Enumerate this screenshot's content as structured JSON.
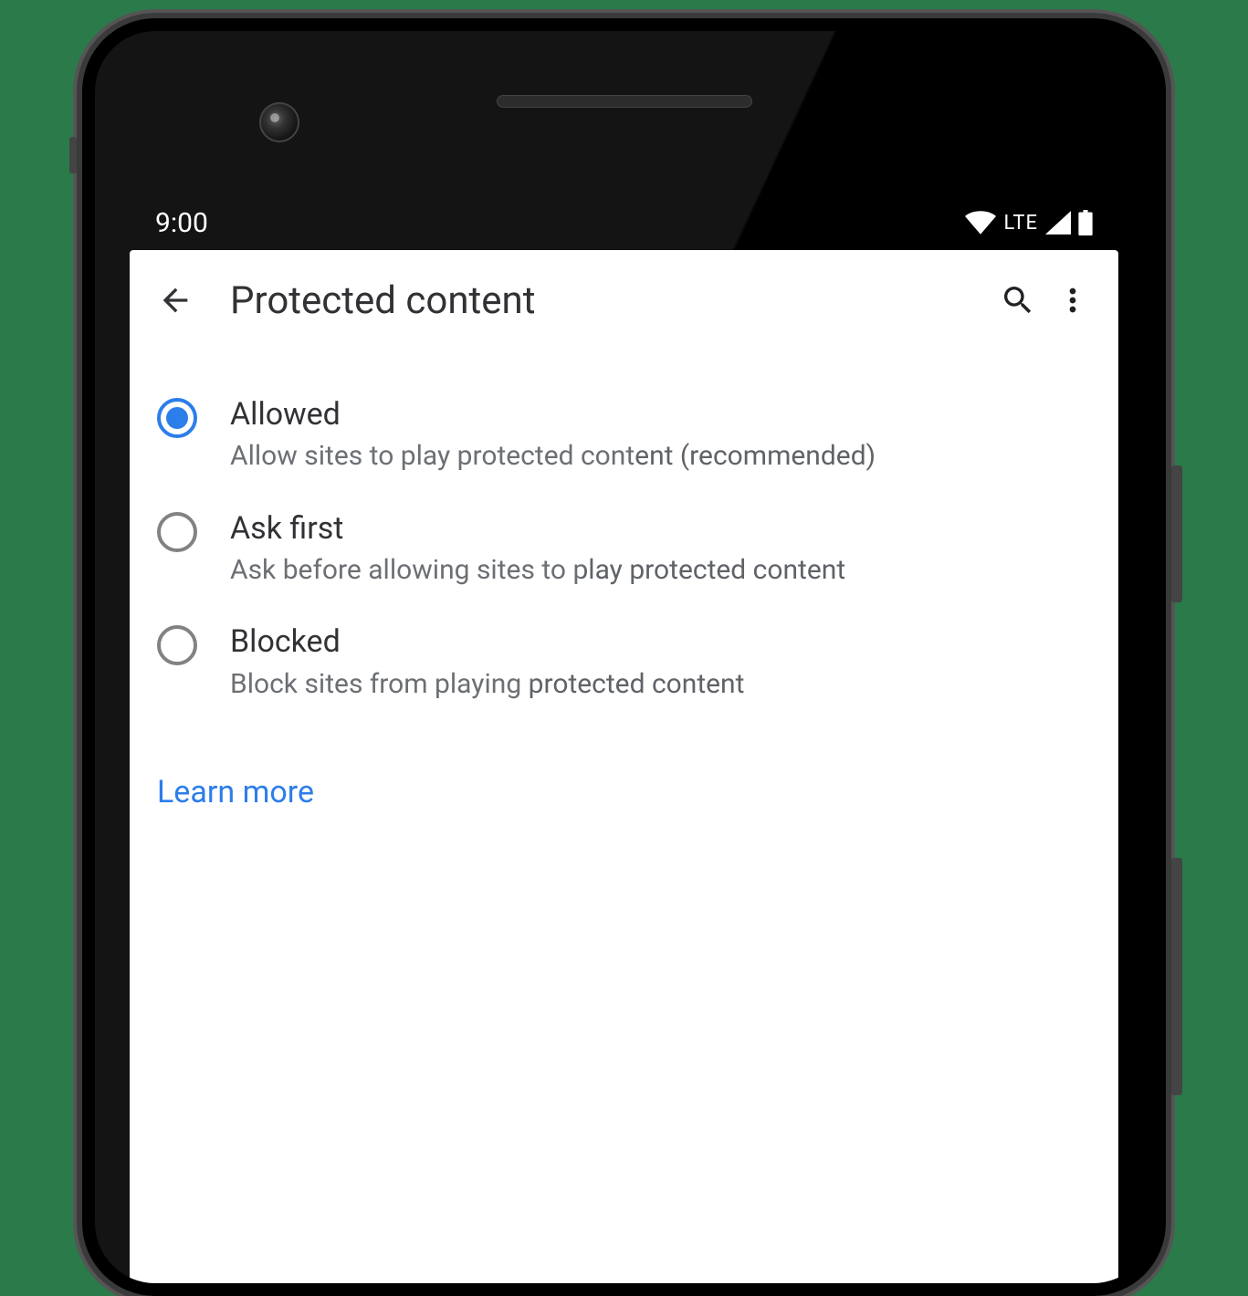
{
  "statusBar": {
    "time": "9:00",
    "networkLabel": "LTE"
  },
  "appBar": {
    "title": "Protected content"
  },
  "options": [
    {
      "title": "Allowed",
      "desc": "Allow sites to play protected content (recommended)",
      "selected": true
    },
    {
      "title": "Ask first",
      "desc": "Ask before allowing sites to play protected content",
      "selected": false
    },
    {
      "title": "Blocked",
      "desc": "Block sites from playing protected content",
      "selected": false
    }
  ],
  "learnMore": "Learn more"
}
